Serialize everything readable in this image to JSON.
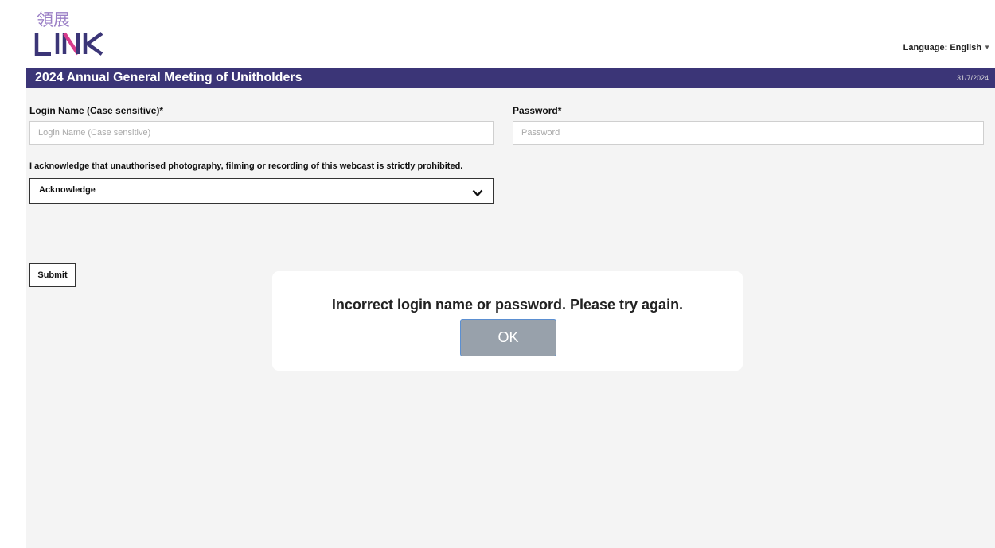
{
  "header": {
    "logo_chinese": "領展",
    "logo_text": "LINK",
    "language_label": "Language: English"
  },
  "titlebar": {
    "title": "2024 Annual General Meeting of Unitholders",
    "date": "31/7/2024"
  },
  "form": {
    "login_label": "Login Name (Case sensitive)*",
    "login_placeholder": "Login Name (Case sensitive)",
    "login_value": "",
    "password_label": "Password*",
    "password_placeholder": "Password",
    "password_value": "",
    "acknowledge_text": "I acknowledge that unauthorised photography, filming or recording of this webcast is strictly prohibited.",
    "acknowledge_selected": "Acknowledge",
    "submit_label": "Submit"
  },
  "dialog": {
    "message": "Incorrect login name or password. Please try again.",
    "ok_label": "OK"
  },
  "colors": {
    "brand_purple": "#3b3577",
    "logo_lilac": "#9b7fc6",
    "logo_pink": "#d63c8c"
  }
}
